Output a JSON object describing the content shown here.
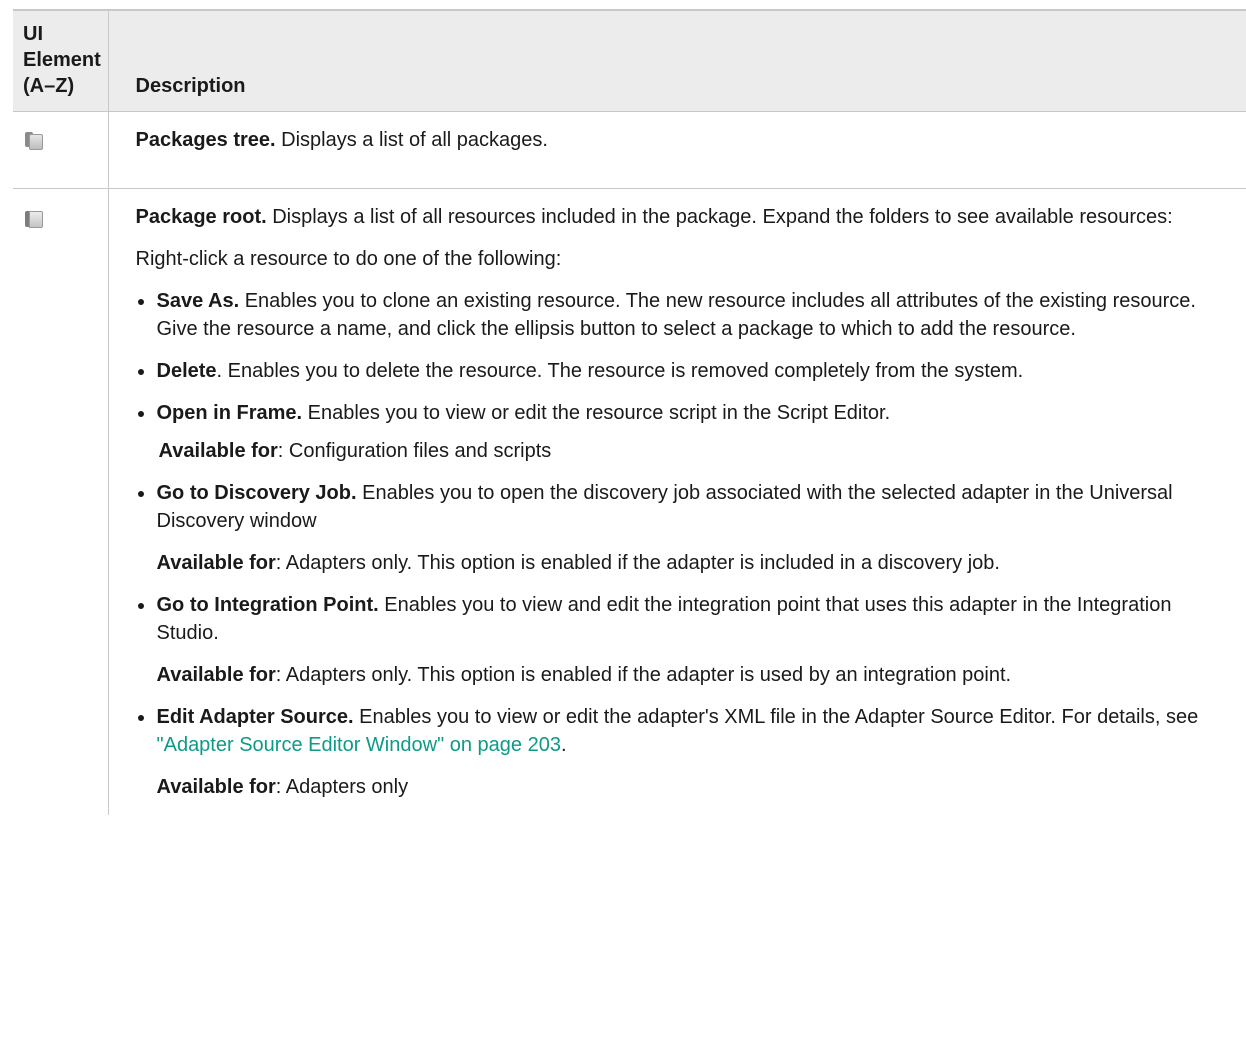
{
  "header": {
    "ui_element_line1": "UI",
    "ui_element_line2": "Element",
    "ui_element_line3": "(A–Z)",
    "description": "Description"
  },
  "rows": [
    {
      "icon": "packages-tree-icon",
      "title": "Packages tree.",
      "text": " Displays a list of all packages."
    },
    {
      "icon": "package-root-icon",
      "title": "Package root.",
      "text": " Displays a list of all resources included in the package. Expand the folders to see available resources:",
      "intro": "Right-click a resource to do one of the following:",
      "options": [
        {
          "title": "Save As.",
          "text": " Enables you to clone an existing resource. The new resource includes all attributes of the existing resource. Give the resource a name, and click the ellipsis  button to select a package to which to add the resource."
        },
        {
          "title": "Delete",
          "text": ". Enables you to delete the resource. The resource is removed completely from the system."
        },
        {
          "title": "Open in Frame.",
          "text": " Enables you to view or edit the resource script in the Script Editor.",
          "avail_label": "Available for",
          "avail_text": ": Configuration files and scripts"
        },
        {
          "title": "Go to Discovery Job.",
          "text": " Enables you to open the discovery job associated with the selected adapter in the Universal Discovery window",
          "avail_label": "Available for",
          "avail_text": ": Adapters only. This option is enabled if the adapter is included in a discovery job."
        },
        {
          "title": "Go to Integration Point.",
          "text": " Enables you to view and edit the integration point that uses this adapter in the Integration Studio.",
          "avail_label": "Available for",
          "avail_text": ": Adapters only. This option is enabled if the adapter is used by an integration point."
        },
        {
          "title": "Edit Adapter Source.",
          "text": " Enables you to view or edit the adapter's XML file in the Adapter Source Editor. For details, see ",
          "link": "\"Adapter Source Editor Window\" on page 203",
          "text_after": ".",
          "avail_label": "Available for",
          "avail_text": ": Adapters only"
        }
      ]
    }
  ],
  "colors": {
    "header_bg": "#ececec",
    "border": "#c8c8c8",
    "link": "#0d9a86",
    "text": "#1a1a1a"
  }
}
